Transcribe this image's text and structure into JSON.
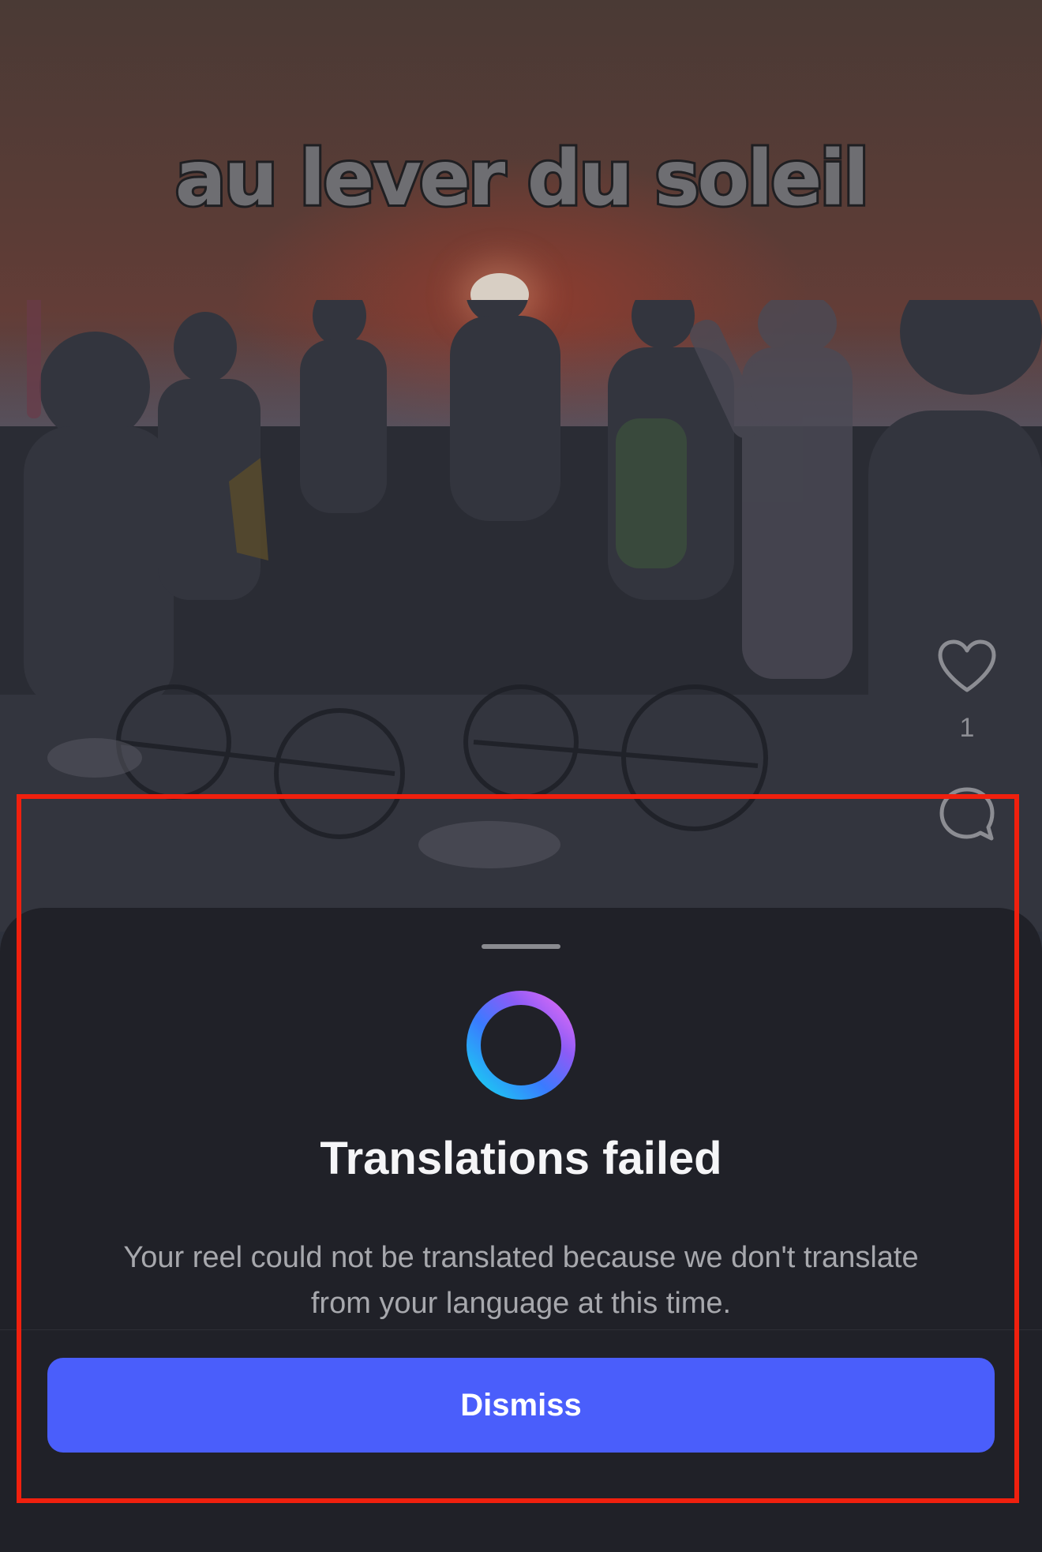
{
  "reel": {
    "caption": "au lever du soleil",
    "like_count": "1",
    "icons": {
      "like": "heart-icon",
      "comment": "comment-bubble-icon"
    }
  },
  "sheet": {
    "title": "Translations failed",
    "message": "Your reel could not be translated because we don't translate from your language at this time.",
    "dismiss_label": "Dismiss",
    "icon": "gradient-ring-icon"
  },
  "colors": {
    "sheet_background": "#202128",
    "button_accent": "#4a5efb",
    "highlight_border": "#f0200e",
    "ring_gradient": [
      "#19d3f0",
      "#3a7bff",
      "#8b5cf6",
      "#e26cf5"
    ]
  }
}
